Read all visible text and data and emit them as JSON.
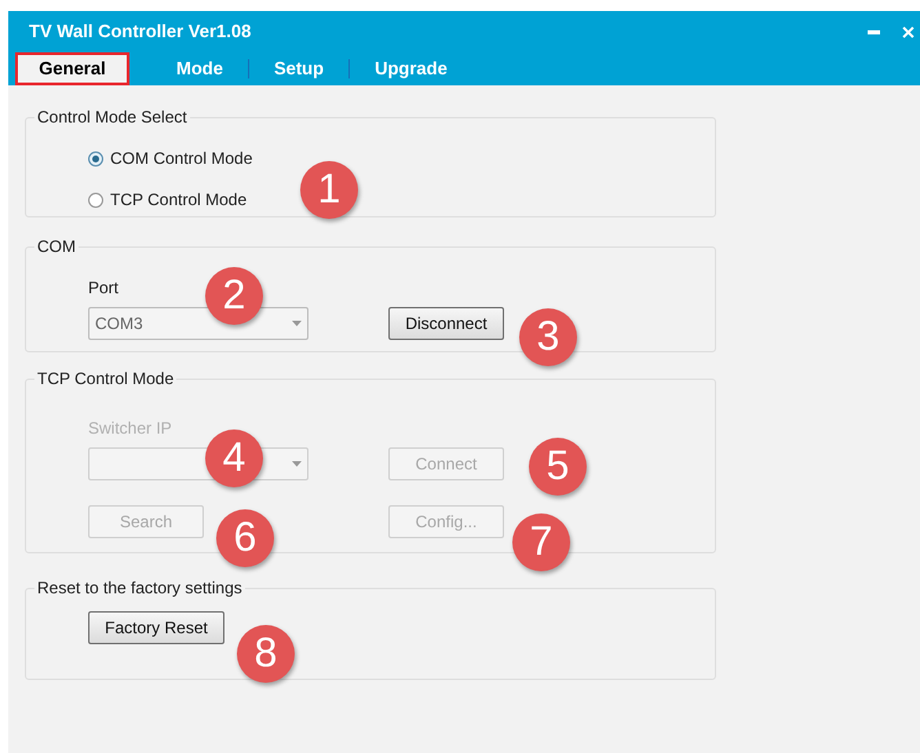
{
  "window": {
    "title": "TV Wall Controller Ver1.08"
  },
  "tabs": [
    {
      "label": "General",
      "selected": true
    },
    {
      "label": "Mode",
      "selected": false
    },
    {
      "label": "Setup",
      "selected": false
    },
    {
      "label": "Upgrade",
      "selected": false
    }
  ],
  "control_mode_select": {
    "title": "Control Mode Select",
    "options": [
      {
        "label": "COM Control Mode",
        "selected": true
      },
      {
        "label": "TCP Control Mode",
        "selected": false
      }
    ],
    "callout": "1"
  },
  "com": {
    "title": "COM",
    "port_label": "Port",
    "port_value": "COM3",
    "disconnect_button": "Disconnect",
    "callouts": [
      "2",
      "3"
    ]
  },
  "tcp": {
    "title": "TCP Control Mode",
    "disabled": true,
    "ip_label": "Switcher IP",
    "connect_button": "Connect",
    "search_button": "Search",
    "config_button": "Config...",
    "callouts": [
      "4",
      "5",
      "6",
      "7"
    ]
  },
  "reset": {
    "title": "Reset to the factory settings",
    "button": "Factory Reset",
    "callout": "8"
  }
}
